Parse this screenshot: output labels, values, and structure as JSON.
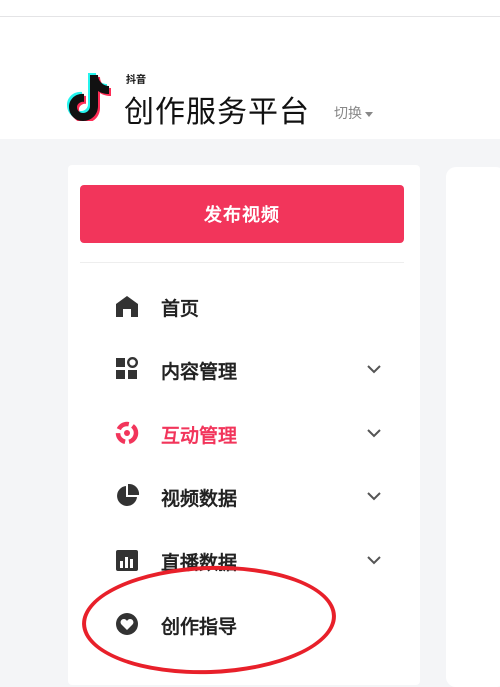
{
  "brand": {
    "small": "抖音",
    "title": "创作服务平台",
    "switch_label": "切换"
  },
  "sidebar": {
    "publish_label": "发布视频",
    "items": [
      {
        "label": "首页",
        "icon": "home-icon",
        "expandable": false,
        "active": false
      },
      {
        "label": "内容管理",
        "icon": "content-grid-icon",
        "expandable": true,
        "active": false
      },
      {
        "label": "互动管理",
        "icon": "interaction-icon",
        "expandable": true,
        "active": true
      },
      {
        "label": "视频数据",
        "icon": "pie-chart-icon",
        "expandable": true,
        "active": false
      },
      {
        "label": "直播数据",
        "icon": "bar-chart-icon",
        "expandable": true,
        "active": false
      },
      {
        "label": "创作指导",
        "icon": "heart-circle-icon",
        "expandable": false,
        "active": false
      }
    ]
  },
  "colors": {
    "accent": "#f2355b",
    "annotation": "#e8202a"
  }
}
